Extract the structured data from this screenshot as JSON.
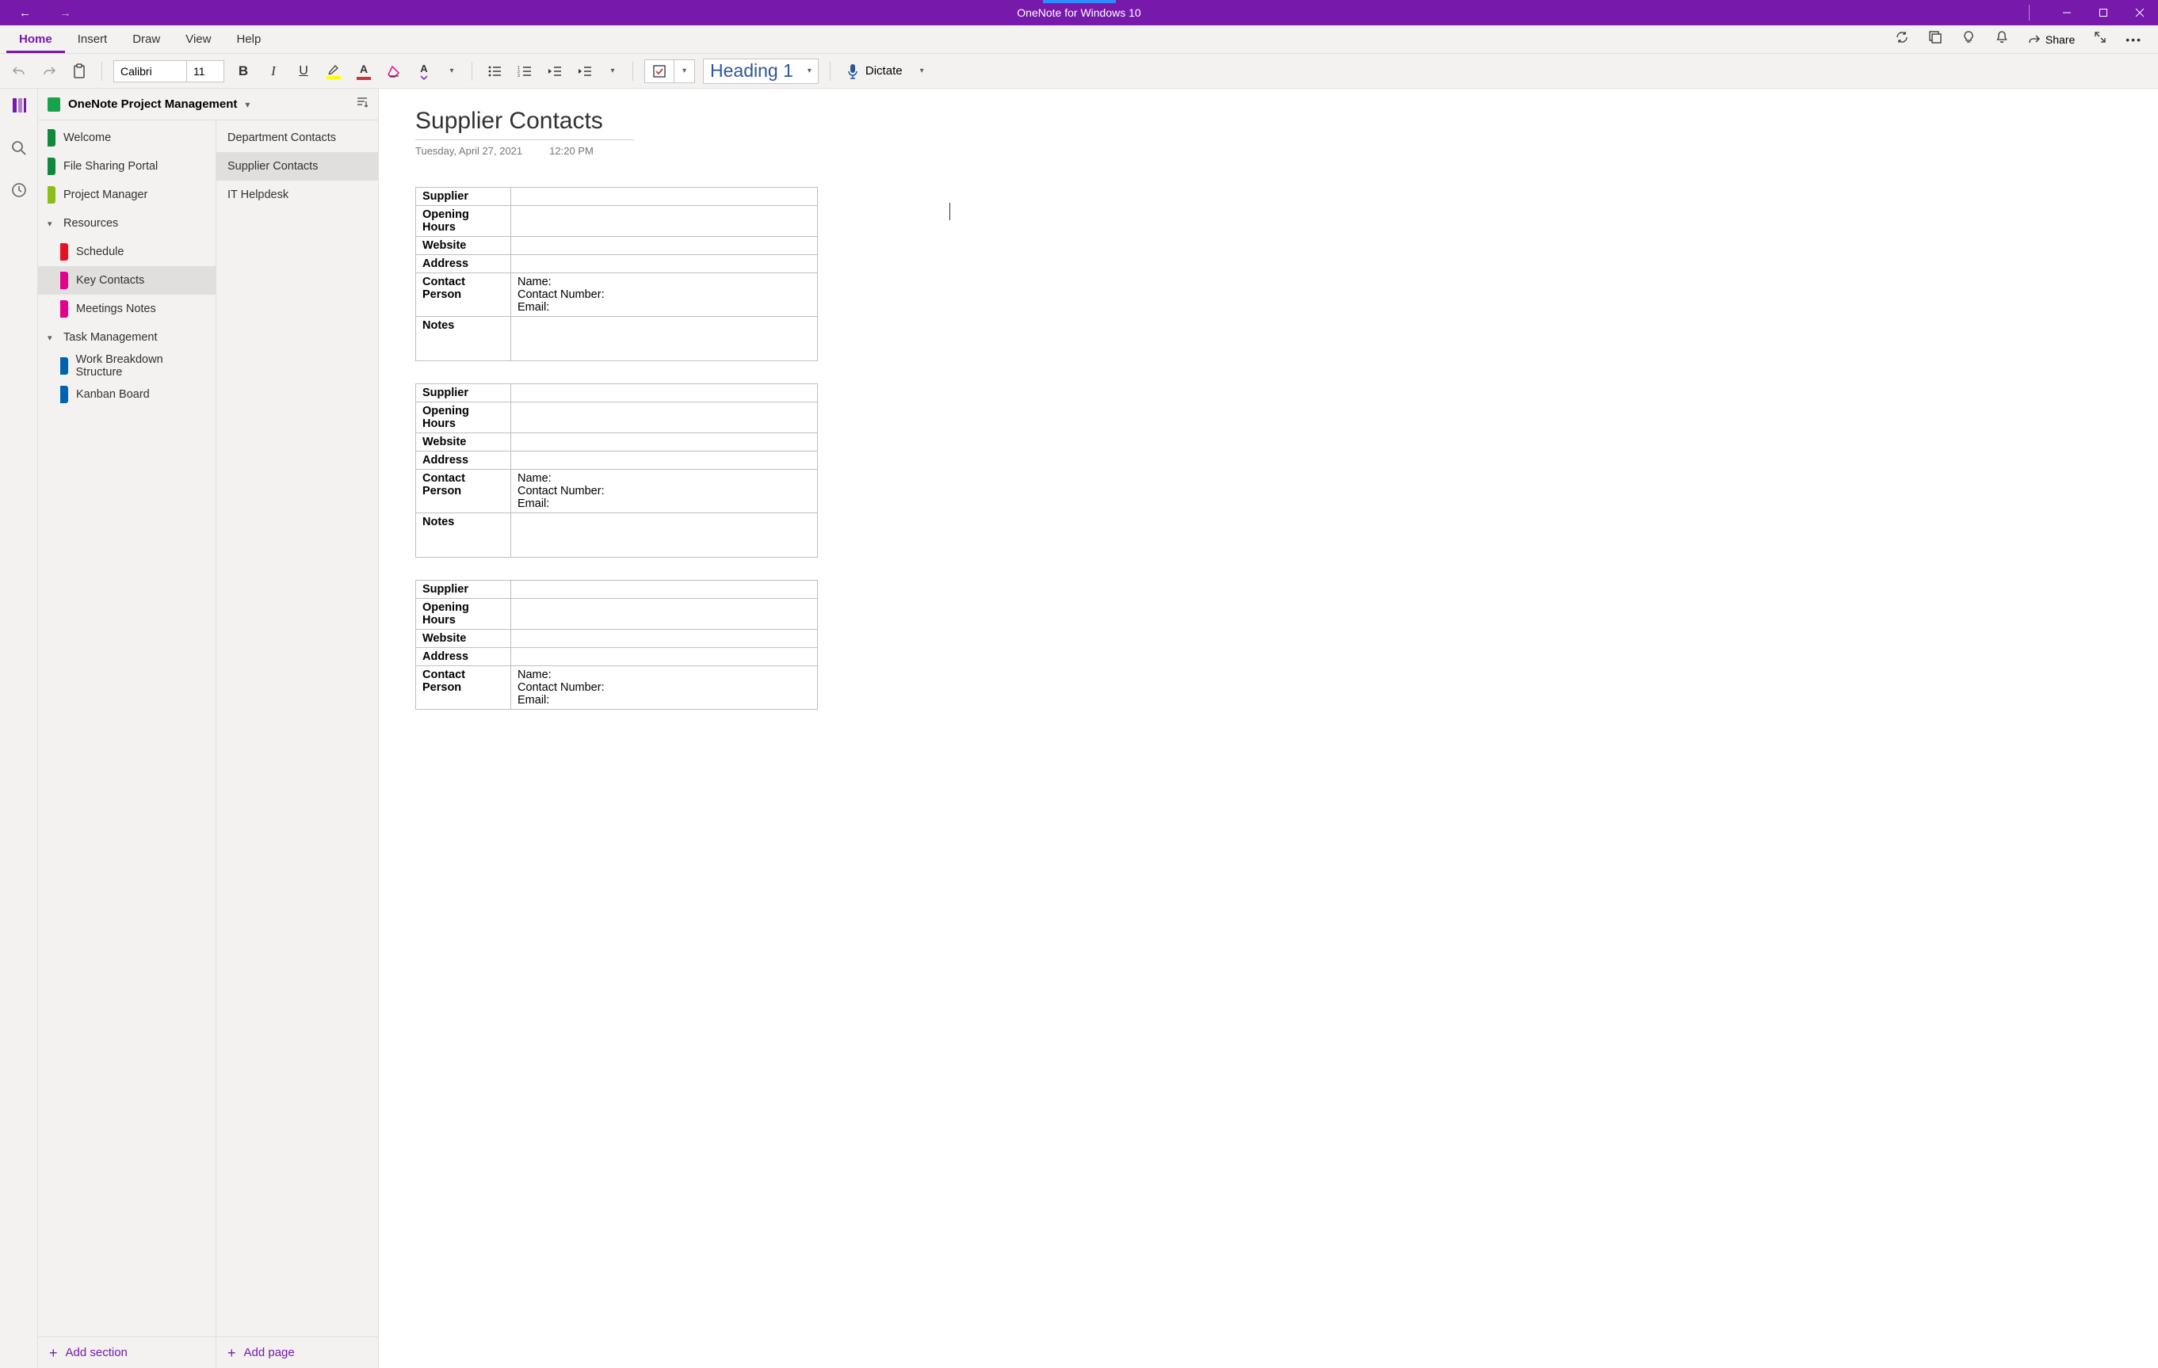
{
  "titlebar": {
    "title": "OneNote for Windows 10"
  },
  "ribbon_tabs": {
    "home": "Home",
    "insert": "Insert",
    "draw": "Draw",
    "view": "View",
    "help": "Help",
    "share": "Share"
  },
  "toolbar": {
    "font": "Calibri",
    "size": "11",
    "style": "Heading 1",
    "dictate": "Dictate"
  },
  "notebook": {
    "title": "OneNote Project Management"
  },
  "sections": {
    "welcome": "Welcome",
    "file_sharing": "File Sharing Portal",
    "project_manager": "Project Manager",
    "resources": "Resources",
    "schedule": "Schedule",
    "key_contacts": "Key Contacts",
    "meetings_notes": "Meetings Notes",
    "task_mgmt": "Task Management",
    "wbs": "Work Breakdown Structure",
    "kanban": "Kanban Board"
  },
  "pages": {
    "dept": "Department Contacts",
    "supplier": "Supplier Contacts",
    "ithelp": "IT Helpdesk"
  },
  "footer": {
    "add_section": "Add section",
    "add_page": "Add page"
  },
  "page": {
    "title": "Supplier Contacts",
    "date": "Tuesday, April 27, 2021",
    "time": "12:20 PM",
    "labels": {
      "supplier": "Supplier",
      "hours": "Opening Hours",
      "website": "Website",
      "address": "Address",
      "contact": "Contact Person",
      "notes": "Notes",
      "name": "Name:",
      "number": "Contact Number:",
      "email": "Email:"
    }
  }
}
